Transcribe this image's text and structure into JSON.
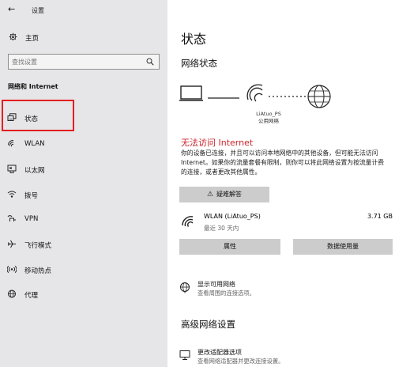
{
  "app": {
    "title": "设置"
  },
  "sidebar": {
    "home_label": "主页",
    "search_placeholder": "查找设置",
    "section_title": "网络和 Internet",
    "items": [
      {
        "label": "状态",
        "icon": "status-icon"
      },
      {
        "label": "WLAN",
        "icon": "wifi-icon"
      },
      {
        "label": "以太网",
        "icon": "ethernet-icon"
      },
      {
        "label": "拨号",
        "icon": "dialup-icon"
      },
      {
        "label": "VPN",
        "icon": "vpn-icon"
      },
      {
        "label": "飞行模式",
        "icon": "airplane-icon"
      },
      {
        "label": "移动热点",
        "icon": "hotspot-icon"
      },
      {
        "label": "代理",
        "icon": "proxy-icon"
      }
    ],
    "selected_item": "状态",
    "highlight_color": "#e31f1f"
  },
  "main": {
    "page_title": "状态",
    "network_status_title": "网络状态",
    "diagram": {
      "connection_name": "LiAtuo_PS",
      "network_type": "公用网络"
    },
    "no_internet": "无法访问 Internet",
    "no_internet_color": "#c9252c",
    "description": "你的设备已连接，并且可以访问本地网络中的其他设备，但可能无法访问 Internet。如果你的流量套餐有限制，则你可以将此网络设置为按流量计费的连接，或者更改其他属性。",
    "troubleshoot_button": "疑难解答",
    "wlan": {
      "name": "WLAN (LiAtuo_PS)",
      "last_seen": "最近 30 天内",
      "data_used": "3.71 GB"
    },
    "properties_button": "属性",
    "data_usage_button": "数据使用量",
    "show_networks": {
      "title": "显示可用网络",
      "subtitle": "查看周围的连接选项。"
    },
    "advanced_title": "高级网络设置",
    "change_adapter": {
      "title": "更改适配器选项",
      "subtitle": "查看网络适配器并更改连接设置。"
    }
  }
}
